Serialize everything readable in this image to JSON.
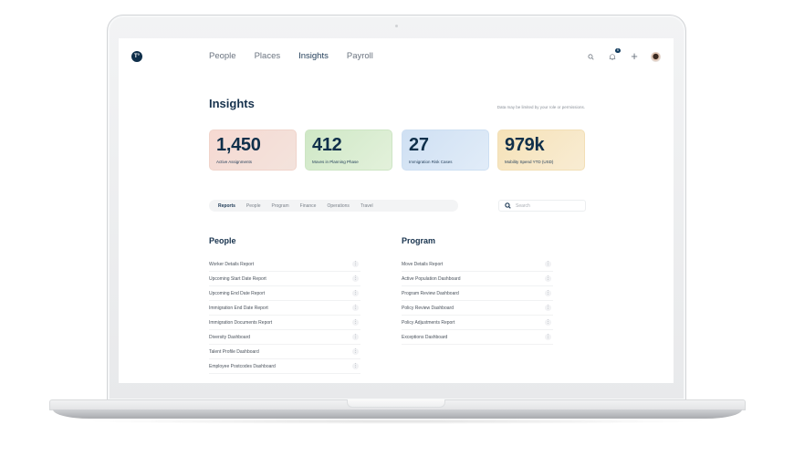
{
  "app": {
    "logo_text": "T°",
    "nav": [
      {
        "label": "People",
        "active": false
      },
      {
        "label": "Places",
        "active": false
      },
      {
        "label": "Insights",
        "active": true
      },
      {
        "label": "Payroll",
        "active": false
      }
    ],
    "actions": {
      "search_icon": "search-icon",
      "notifications_icon": "bell-icon",
      "notifications_badge": "6",
      "add_icon": "plus-icon",
      "add_label": "+",
      "avatar": "user-avatar"
    }
  },
  "page": {
    "title": "Insights",
    "disclaimer": "Data may be limited by your role or permissions."
  },
  "stats": [
    {
      "value": "1,450",
      "label": "Active Assignments",
      "color": "#f6d9d2"
    },
    {
      "value": "412",
      "label": "Moves in Planning Phase",
      "color": "#cfe8c6"
    },
    {
      "value": "27",
      "label": "Immigration Risk Cases",
      "color": "#cfe0f3"
    },
    {
      "value": "979k",
      "label": "Mobility Spend YTD (USD)",
      "color": "#f6e2b8"
    }
  ],
  "tabs": [
    {
      "label": "Reports",
      "active": true
    },
    {
      "label": "People",
      "active": false
    },
    {
      "label": "Program",
      "active": false
    },
    {
      "label": "Finance",
      "active": false
    },
    {
      "label": "Operations",
      "active": false
    },
    {
      "label": "Travel",
      "active": false
    }
  ],
  "search": {
    "placeholder": "Search",
    "value": ""
  },
  "sections": {
    "people": {
      "title": "People",
      "items": [
        "Worker Details Report",
        "Upcoming Start Date Report",
        "Upcoming End Date Report",
        "Immigration End Date Report",
        "Immigration Documents Report",
        "Diversity Dashboard",
        "Talent Profile Dashboard",
        "Employee Postcodes Dashboard"
      ]
    },
    "program": {
      "title": "Program",
      "items": [
        "Move Details Report",
        "Active Population Dashboard",
        "Program Review Dashboard",
        "Policy Review Dashboard",
        "Policy Adjustments Report",
        "Exceptions Dashboard"
      ]
    }
  },
  "item_menu_glyph": "⋮",
  "colors": {
    "brand_dark": "#0f2f4a",
    "title": "#17324d",
    "nav_text": "#6b7480"
  }
}
